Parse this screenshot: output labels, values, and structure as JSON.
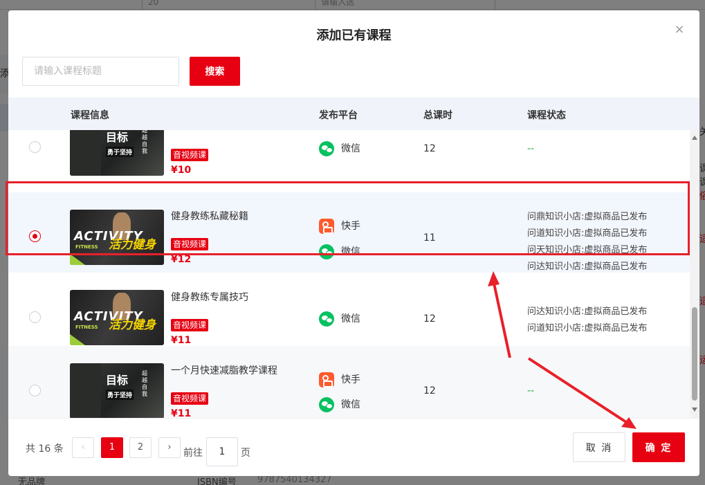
{
  "background": {
    "left_text": "添",
    "right_texts": [
      "关",
      "课",
      "课",
      "俗",
      "适",
      "适",
      "运"
    ],
    "bottom_left": "无品牌",
    "bottom_mid": "ISBN编号",
    "bottom_right": "9787540134327",
    "top_cell_1": "20",
    "top_cell_2": "请输入选"
  },
  "dialog": {
    "title": "添加已有课程",
    "close_glyph": "×"
  },
  "search": {
    "placeholder": "请输入课程标题",
    "button_label": "搜索"
  },
  "table": {
    "headers": {
      "info": "课程信息",
      "platform": "发布平台",
      "hours": "总课时",
      "status": "课程状态"
    },
    "rows": [
      {
        "title": "",
        "tag": "音视频课",
        "price": "¥10",
        "platforms": [
          "微信"
        ],
        "hours": "12",
        "status": [
          "--"
        ],
        "thumb_text": "目标",
        "thumb_sub": "勇于坚持",
        "thumb_side": "超越自我",
        "selected": false
      },
      {
        "title": "健身教练私藏秘籍",
        "tag": "音视频课",
        "price": "¥12",
        "platforms": [
          "快手",
          "微信"
        ],
        "hours": "11",
        "status": [
          "问鼎知识小店:虚拟商品已发布",
          "问道知识小店:虚拟商品已发布",
          "问天知识小店:虚拟商品已发布",
          "问达知识小店:虚拟商品已发布"
        ],
        "thumb_text": "ACTIVITY",
        "thumb_sub": "FITNESS",
        "thumb_side": "活力健身",
        "selected": true
      },
      {
        "title": "健身教练专属技巧",
        "tag": "音视频课",
        "price": "¥11",
        "platforms": [
          "微信"
        ],
        "hours": "12",
        "status": [
          "问达知识小店:虚拟商品已发布",
          "问道知识小店:虚拟商品已发布"
        ],
        "thumb_text": "ACTIVITY",
        "thumb_sub": "FITNESS",
        "thumb_side": "活力健身",
        "selected": false
      },
      {
        "title": "一个月快速减脂教学课程",
        "tag": "音视频课",
        "price": "¥11",
        "platforms": [
          "快手",
          "微信"
        ],
        "hours": "12",
        "status": [
          "--"
        ],
        "thumb_text": "目标",
        "thumb_sub": "勇于坚持",
        "thumb_side": "超越自我",
        "selected": false
      }
    ]
  },
  "pagination": {
    "total": "共 16 条",
    "prev": "‹",
    "next": "›",
    "pages": [
      "1",
      "2"
    ],
    "current": "1",
    "goto_label": "前往",
    "goto_value": "1",
    "page_label": "页"
  },
  "footer": {
    "cancel_label": "取 消",
    "confirm_label": "确 定"
  },
  "colors": {
    "accent": "#e60012",
    "annotation": "#e8202a",
    "wechat": "#07c160",
    "kuaishou": "#ff5a2c"
  },
  "icons": {
    "wechat": "wechat-icon",
    "kuaishou": "kuaishou-icon",
    "close": "close-icon"
  }
}
